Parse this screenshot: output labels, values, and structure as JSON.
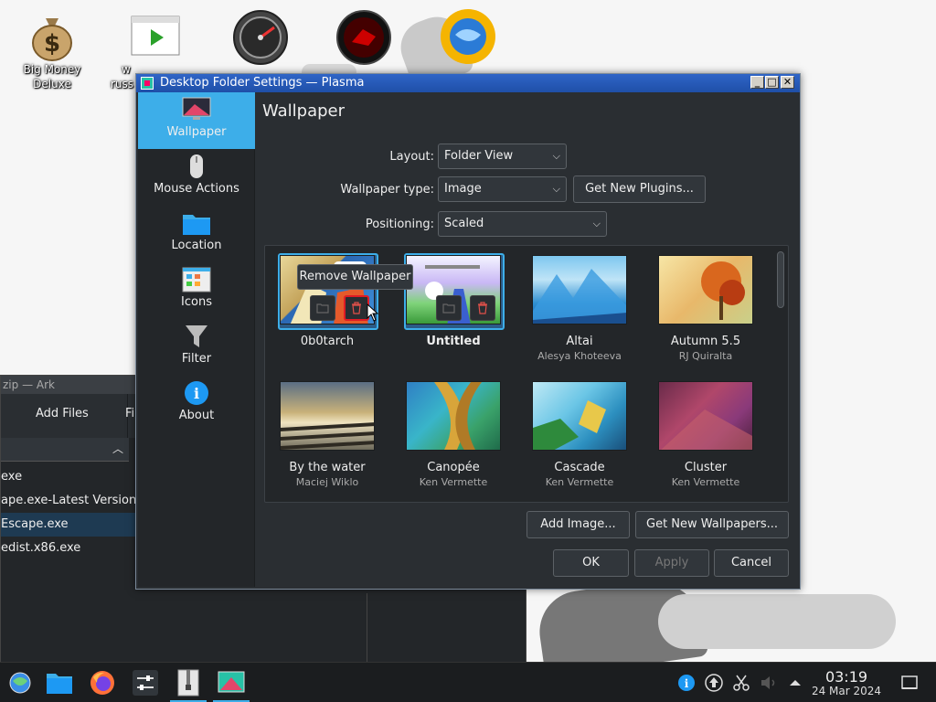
{
  "desktop": {
    "icons": [
      {
        "label_line1": "Big Money",
        "label_line2": "Deluxe",
        "icon": "money-bag-icon"
      },
      {
        "label_line1": "w",
        "label_line2": "russ",
        "icon": "media-player-icon"
      },
      {
        "label_line1": "",
        "label_line2": "",
        "icon": "speedometer-icon"
      },
      {
        "label_line1": "",
        "label_line2": "",
        "icon": "red-disc-icon"
      },
      {
        "label_line1": "",
        "label_line2": "",
        "icon": "sun-globe-icon"
      }
    ]
  },
  "ark": {
    "title": "zip — Ark",
    "toolbar_add_files": "Add Files",
    "toolbar_fi": "Fi",
    "rows": [
      "exe",
      "ape.exe-Latest Version",
      "Escape.exe",
      "edist.x86.exe"
    ],
    "selected_row": 2
  },
  "dialog": {
    "title": "Desktop Folder Settings — Plasma",
    "sidebar": [
      {
        "label": "Wallpaper",
        "icon": "monitor-icon",
        "active": true
      },
      {
        "label": "Mouse Actions",
        "icon": "mouse-icon",
        "active": false
      },
      {
        "label": "Location",
        "icon": "folder-icon",
        "active": false
      },
      {
        "label": "Icons",
        "icon": "icons-view-icon",
        "active": false
      },
      {
        "label": "Filter",
        "icon": "filter-icon",
        "active": false
      },
      {
        "label": "About",
        "icon": "info-icon",
        "active": false
      }
    ],
    "heading": "Wallpaper",
    "form": {
      "layout_label": "Layout:",
      "layout_value": "Folder View",
      "wallpaper_type_label": "Wallpaper type:",
      "wallpaper_type_value": "Image",
      "get_new_plugins": "Get New Plugins...",
      "positioning_label": "Positioning:",
      "positioning_value": "Scaled"
    },
    "wallpapers": [
      {
        "name": "0b0tarch",
        "author": "",
        "selected": false,
        "hovered": true
      },
      {
        "name": "Untitled",
        "author": "",
        "selected": true,
        "hovered": false
      },
      {
        "name": "Altai",
        "author": "Alesya Khoteeva",
        "selected": false,
        "hovered": false
      },
      {
        "name": "Autumn 5.5",
        "author": "RJ Quiralta",
        "selected": false,
        "hovered": false
      },
      {
        "name": "By the water",
        "author": "Maciej Wiklo",
        "selected": false,
        "hovered": false
      },
      {
        "name": "Canopée",
        "author": "Ken Vermette",
        "selected": false,
        "hovered": false
      },
      {
        "name": "Cascade",
        "author": "Ken Vermette",
        "selected": false,
        "hovered": false
      },
      {
        "name": "Cluster",
        "author": "Ken Vermette",
        "selected": false,
        "hovered": false
      }
    ],
    "tooltip": "Remove Wallpaper",
    "buttons": {
      "add_image": "Add Image...",
      "get_new_wallpapers": "Get New Wallpapers...",
      "ok": "OK",
      "apply": "Apply",
      "cancel": "Cancel"
    }
  },
  "taskbar": {
    "apps": [
      "start-menu-icon",
      "file-manager-icon",
      "firefox-icon",
      "settings-icon",
      "archive-icon",
      "plasma-settings-icon"
    ],
    "tray": [
      "info-icon",
      "updates-icon",
      "scissors-icon",
      "volume-muted-icon",
      "tray-expand-icon"
    ],
    "time": "03:19",
    "date": "24 Mar 2024"
  }
}
